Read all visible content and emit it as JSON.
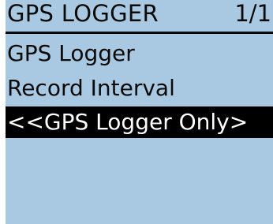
{
  "header": {
    "title": "GPS LOGGER",
    "page": "1/1"
  },
  "menu": {
    "items": [
      {
        "label": "GPS Logger",
        "selected": false
      },
      {
        "label": "Record Interval",
        "selected": false
      },
      {
        "label": "<<GPS Logger Only>",
        "selected": true
      }
    ]
  },
  "colors": {
    "background": "#a9c8e1",
    "text": "#0a0a0a",
    "highlight_bg": "#000000",
    "highlight_text": "#ffffff"
  }
}
